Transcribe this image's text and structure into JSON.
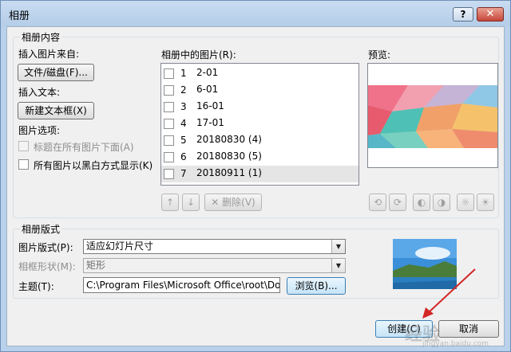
{
  "window": {
    "title": "相册",
    "help_label": "?",
    "close_label": "✕"
  },
  "content_group": {
    "legend": "相册内容",
    "insert_from_label": "插入图片来自:",
    "file_disk_button": "文件/磁盘(F)...",
    "insert_text_label": "插入文本:",
    "new_textbox_button": "新建文本框(X)",
    "picture_options_label": "图片选项:",
    "caption_below_label": "标题在所有图片下面(A)",
    "black_white_label": "所有图片以黑白方式显示(K)",
    "pictures_label": "相册中的图片(R):",
    "preview_label": "预览:",
    "delete_button": "删除(V)",
    "up_arrow": "↑",
    "down_arrow": "↓",
    "pictures": [
      {
        "num": "1",
        "name": "2-01"
      },
      {
        "num": "2",
        "name": "6-01"
      },
      {
        "num": "3",
        "name": "16-01"
      },
      {
        "num": "4",
        "name": "17-01"
      },
      {
        "num": "5",
        "name": "20180830 (4)"
      },
      {
        "num": "6",
        "name": "20180830 (5)"
      },
      {
        "num": "7",
        "name": "20180911 (1)"
      }
    ],
    "selected_index": 7,
    "colors": {
      "selected_row": "#e5e5e5",
      "dialog_bg": "#f0f0f0",
      "frame": "#b9d1ea"
    }
  },
  "layout_group": {
    "legend": "相册版式",
    "picture_layout_label": "图片版式(P):",
    "picture_layout_value": "适应幻灯片尺寸",
    "frame_shape_label": "相框形状(M):",
    "frame_shape_value": "矩形",
    "theme_label": "主题(T):",
    "theme_value": "C:\\Program Files\\Microsoft Office\\root\\Do",
    "browse_button": "浏览(B)..."
  },
  "footer": {
    "create_button": "创建(C)",
    "cancel_button": "取消"
  },
  "watermark": {
    "text": "经验",
    "subtext": "jingyan.baidu.com"
  },
  "icons": [
    "help-icon",
    "close-icon",
    "arrow-up-icon",
    "arrow-down-icon",
    "delete-x-icon",
    "rotate-left-icon",
    "rotate-right-icon",
    "contrast-up-icon",
    "contrast-down-icon",
    "brightness-up-icon",
    "brightness-down-icon",
    "dropdown-arrow-icon"
  ]
}
